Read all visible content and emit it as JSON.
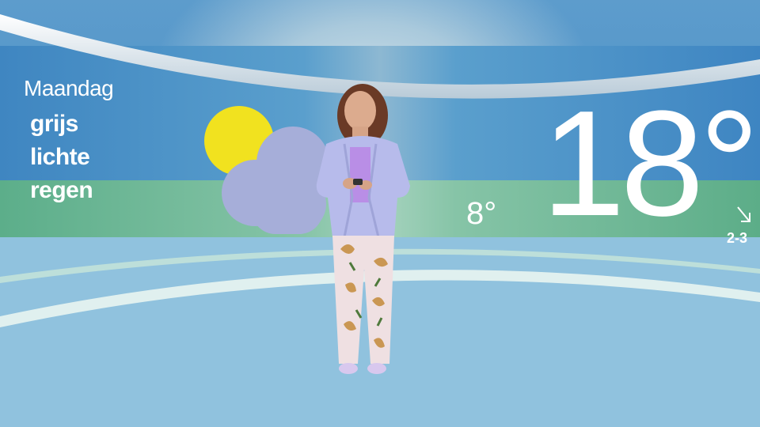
{
  "forecast": {
    "day": "Maandag",
    "description_line1": "grijs",
    "description_line2": "lichte",
    "description_line3": "regen",
    "max_temp": "18°",
    "min_temp": "8°",
    "wind": "2-3",
    "weather_icon": "sun-behind-cloud-icon",
    "wind_icon": "wind-direction-arrow-icon"
  },
  "colors": {
    "sun": "#f1e21f",
    "cloud": "#a6aed9",
    "sky_band": "#4a8fc7",
    "green_band": "#7cc0a0"
  }
}
